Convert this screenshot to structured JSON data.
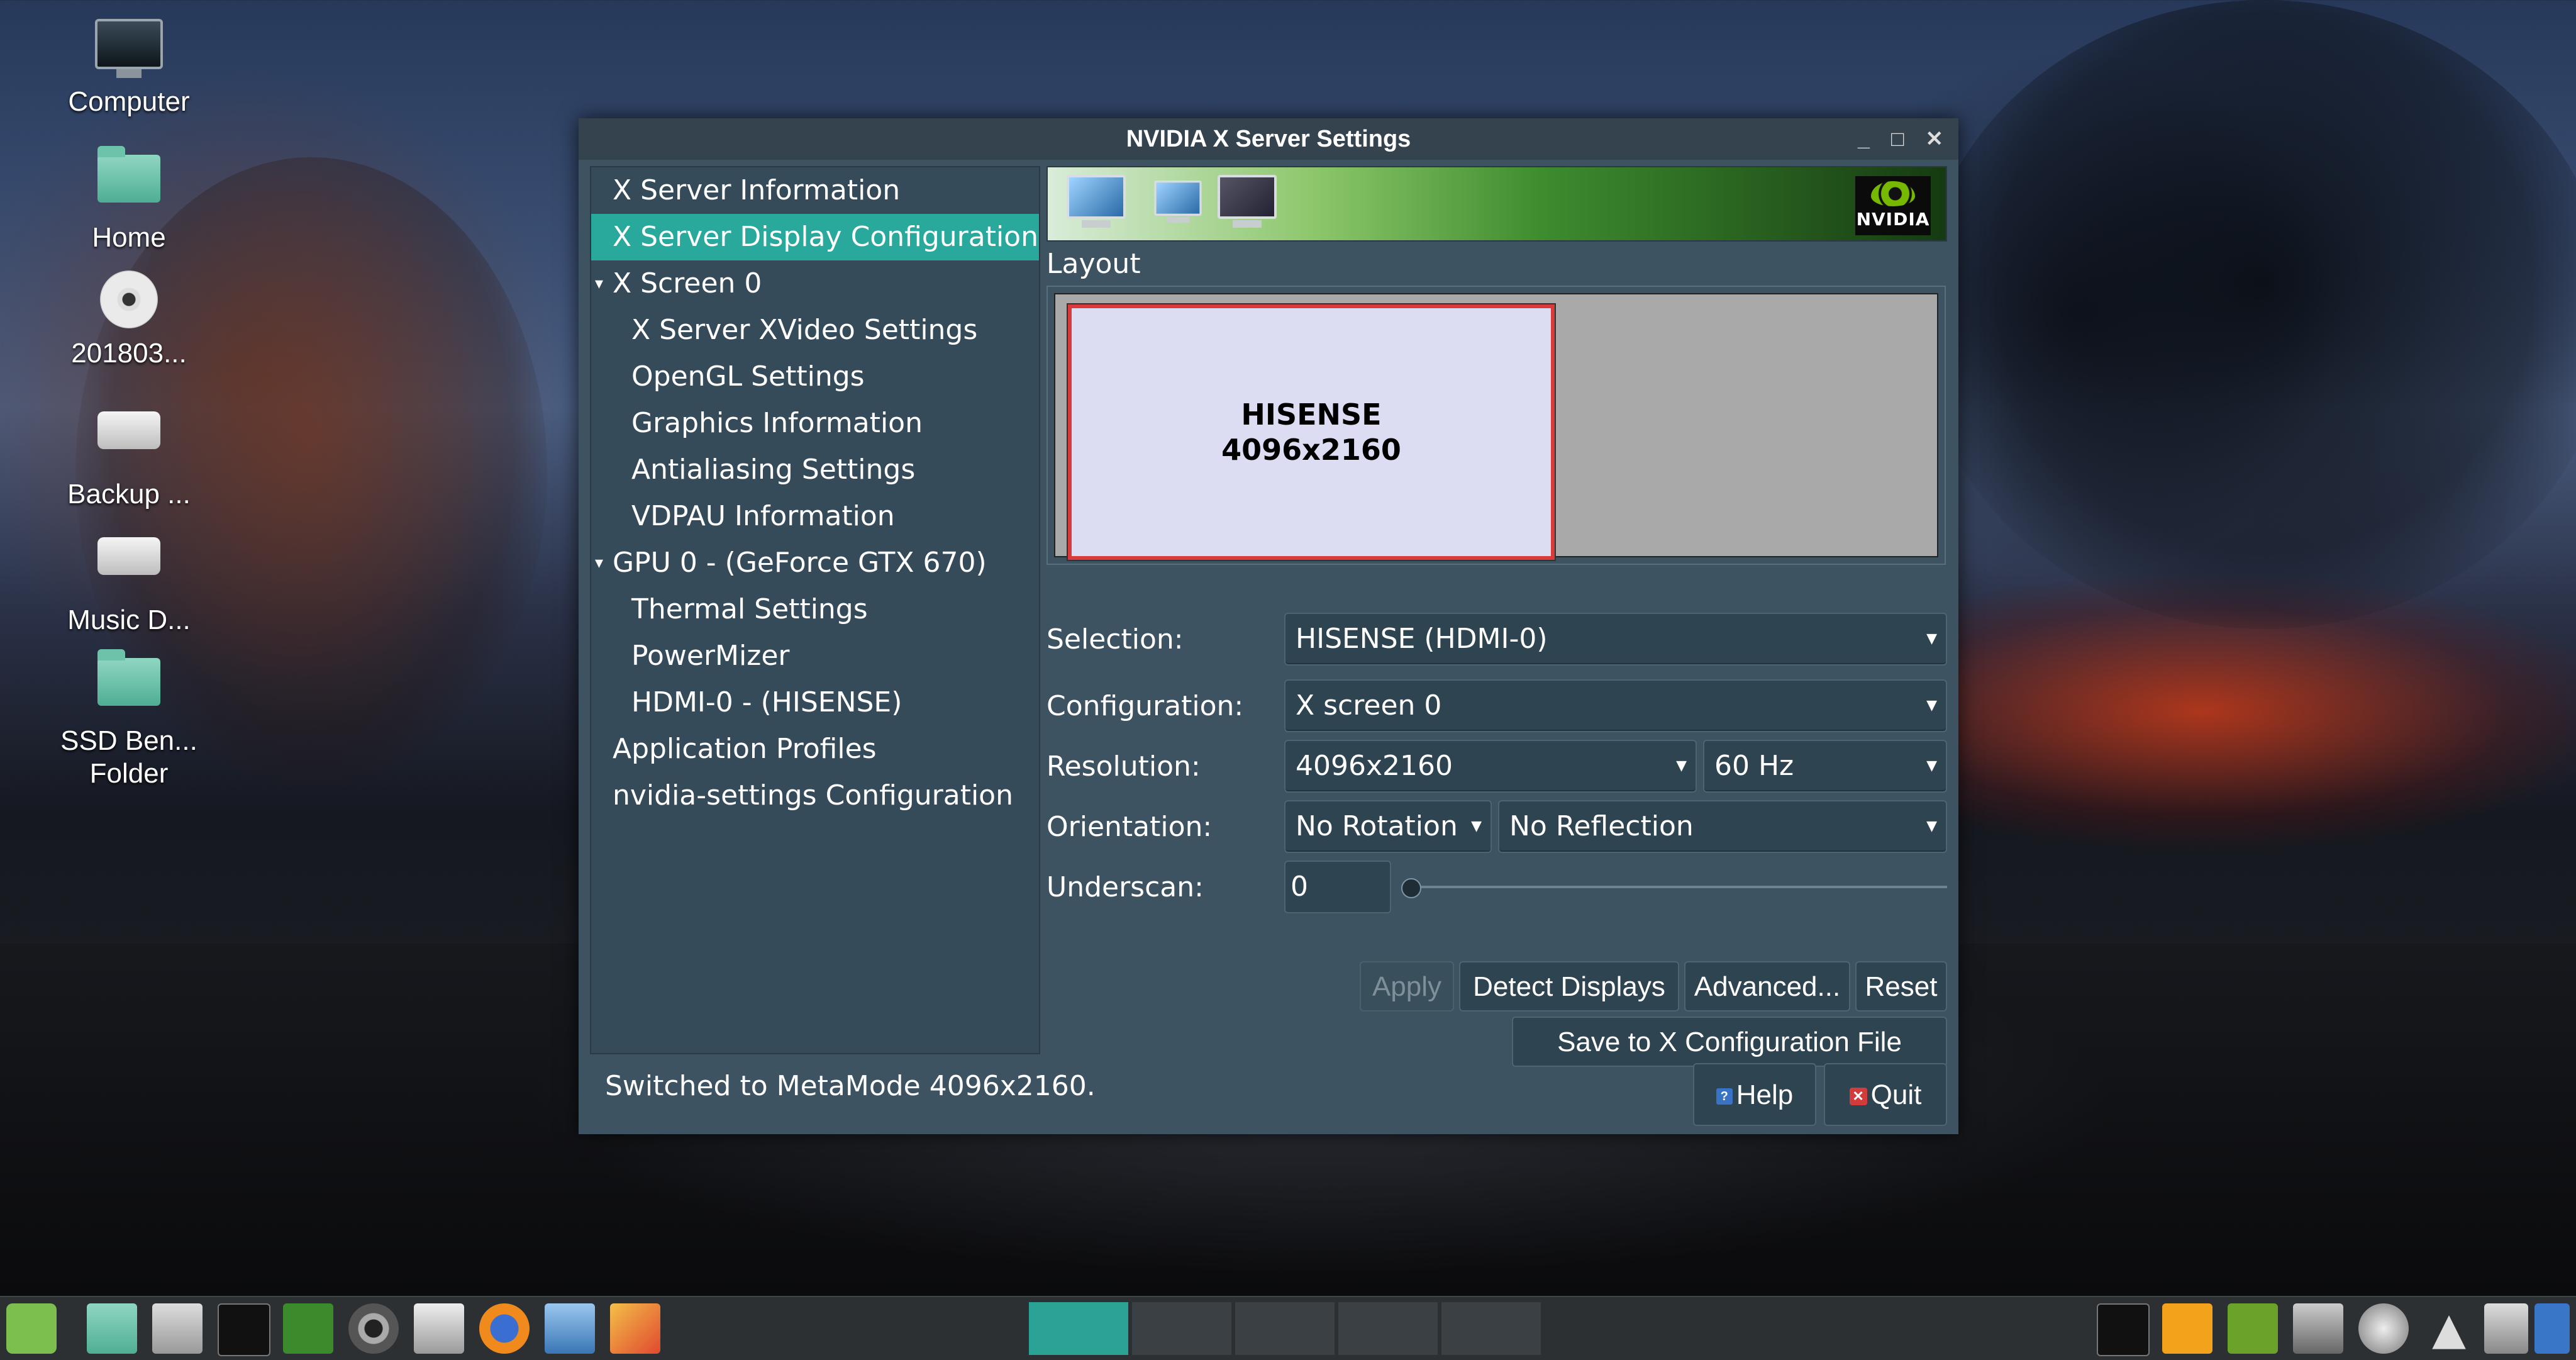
{
  "desktop": {
    "icons": [
      {
        "label": "Computer"
      },
      {
        "label": "Home"
      },
      {
        "label": "201803..."
      },
      {
        "label": "Backup ..."
      },
      {
        "label": "Music D..."
      },
      {
        "label": "SSD Ben... Folder"
      }
    ]
  },
  "window": {
    "title": "NVIDIA X Server Settings",
    "controls": {
      "minimize": "_",
      "maximize": "□",
      "close": "✕"
    }
  },
  "nav": {
    "items": [
      {
        "label": "X Server Information"
      },
      {
        "label": "X Server Display Configuration"
      },
      {
        "label": "X Screen 0"
      },
      {
        "label": "X Server XVideo Settings"
      },
      {
        "label": "OpenGL Settings"
      },
      {
        "label": "Graphics Information"
      },
      {
        "label": "Antialiasing Settings"
      },
      {
        "label": "VDPAU Information"
      },
      {
        "label": "GPU 0 - (GeForce GTX 670)"
      },
      {
        "label": "Thermal Settings"
      },
      {
        "label": "PowerMizer"
      },
      {
        "label": "HDMI-0 - (HISENSE)"
      },
      {
        "label": "Application Profiles"
      },
      {
        "label": "nvidia-settings Configuration"
      }
    ],
    "selected": "X Server Display Configuration"
  },
  "banner": {
    "logo_text": "NVIDIA"
  },
  "layout": {
    "label": "Layout",
    "display_name": "HISENSE",
    "display_resolution": "4096x2160"
  },
  "form": {
    "selection_label": "Selection:",
    "selection_value": "HISENSE (HDMI-0)",
    "configuration_label": "Configuration:",
    "configuration_value": "X screen 0",
    "resolution_label": "Resolution:",
    "resolution_value": "4096x2160",
    "refresh_value": "60 Hz",
    "orientation_label": "Orientation:",
    "rotation_value": "No Rotation",
    "reflection_value": "No Reflection",
    "underscan_label": "Underscan:",
    "underscan_value": "0"
  },
  "buttons": {
    "apply": "Apply",
    "detect": "Detect Displays",
    "advanced": "Advanced...",
    "reset": "Reset",
    "save": "Save to X Configuration File",
    "help": "Help",
    "quit": "Quit"
  },
  "status": {
    "message": "Switched to MetaMode 4096x2160."
  },
  "colors": {
    "accent": "#29a99b",
    "window_bg": "#3d5362",
    "display_border": "#d93a3a"
  }
}
